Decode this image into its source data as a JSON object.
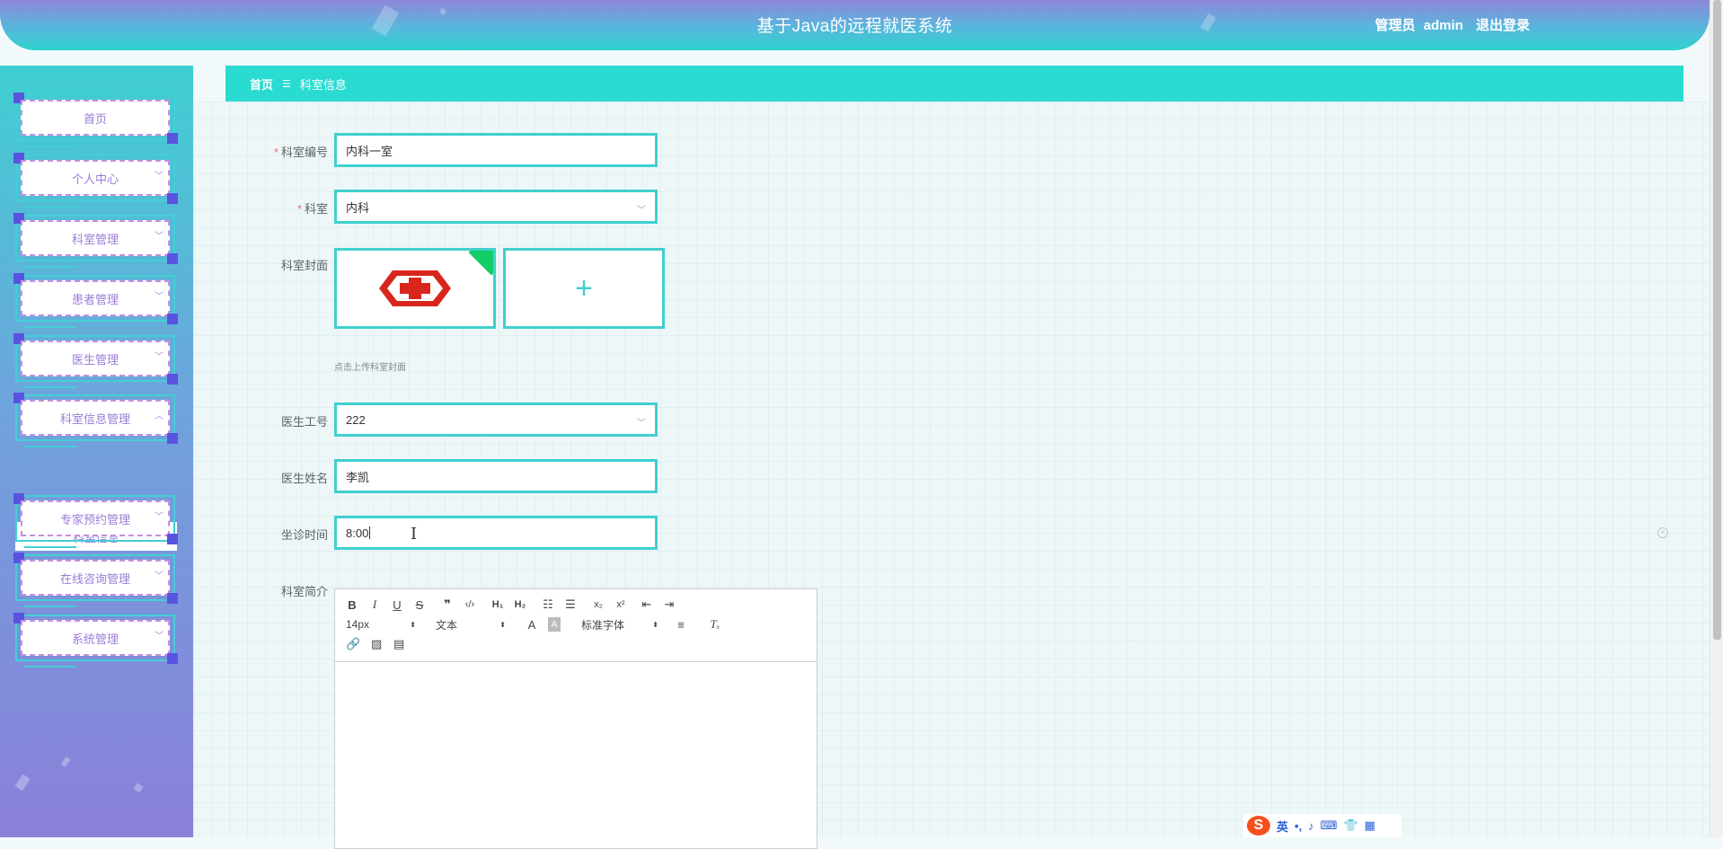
{
  "header": {
    "title": "基于Java的远程就医系统",
    "user_role": "管理员",
    "username": "admin",
    "logout_label": "退出登录"
  },
  "sidebar": {
    "items": [
      {
        "label": "首页",
        "has_arrow": false
      },
      {
        "label": "个人中心",
        "has_arrow": true
      },
      {
        "label": "科室管理",
        "has_arrow": true
      },
      {
        "label": "患者管理",
        "has_arrow": true
      },
      {
        "label": "医生管理",
        "has_arrow": true
      },
      {
        "label": "科室信息管理",
        "has_arrow": true,
        "expanded": true
      },
      {
        "label": "专家预约管理",
        "has_arrow": true
      },
      {
        "label": "在线咨询管理",
        "has_arrow": true
      },
      {
        "label": "系统管理",
        "has_arrow": true
      }
    ],
    "sub_item": "科室信息"
  },
  "breadcrumb": {
    "home": "首页",
    "separator": "☰",
    "current": "科室信息"
  },
  "form": {
    "dept_code_label": "科室编号",
    "dept_code_value": "内科一室",
    "dept_label": "科室",
    "dept_value": "内科",
    "cover_label": "科室封面",
    "cover_hint": "点击上传科室封面",
    "doctor_id_label": "医生工号",
    "doctor_id_value": "222",
    "doctor_name_label": "医生姓名",
    "doctor_name_value": "李凯",
    "time_label": "坐诊时间",
    "time_value": "8:00",
    "intro_label": "科室简介"
  },
  "editor": {
    "font_size": "14px",
    "text_type": "文本",
    "font_family": "标准字体"
  },
  "ime": {
    "mode": "英"
  },
  "colors": {
    "accent": "#2adbd2",
    "menu_text": "#9a7bd9",
    "required": "#f56c6c"
  }
}
